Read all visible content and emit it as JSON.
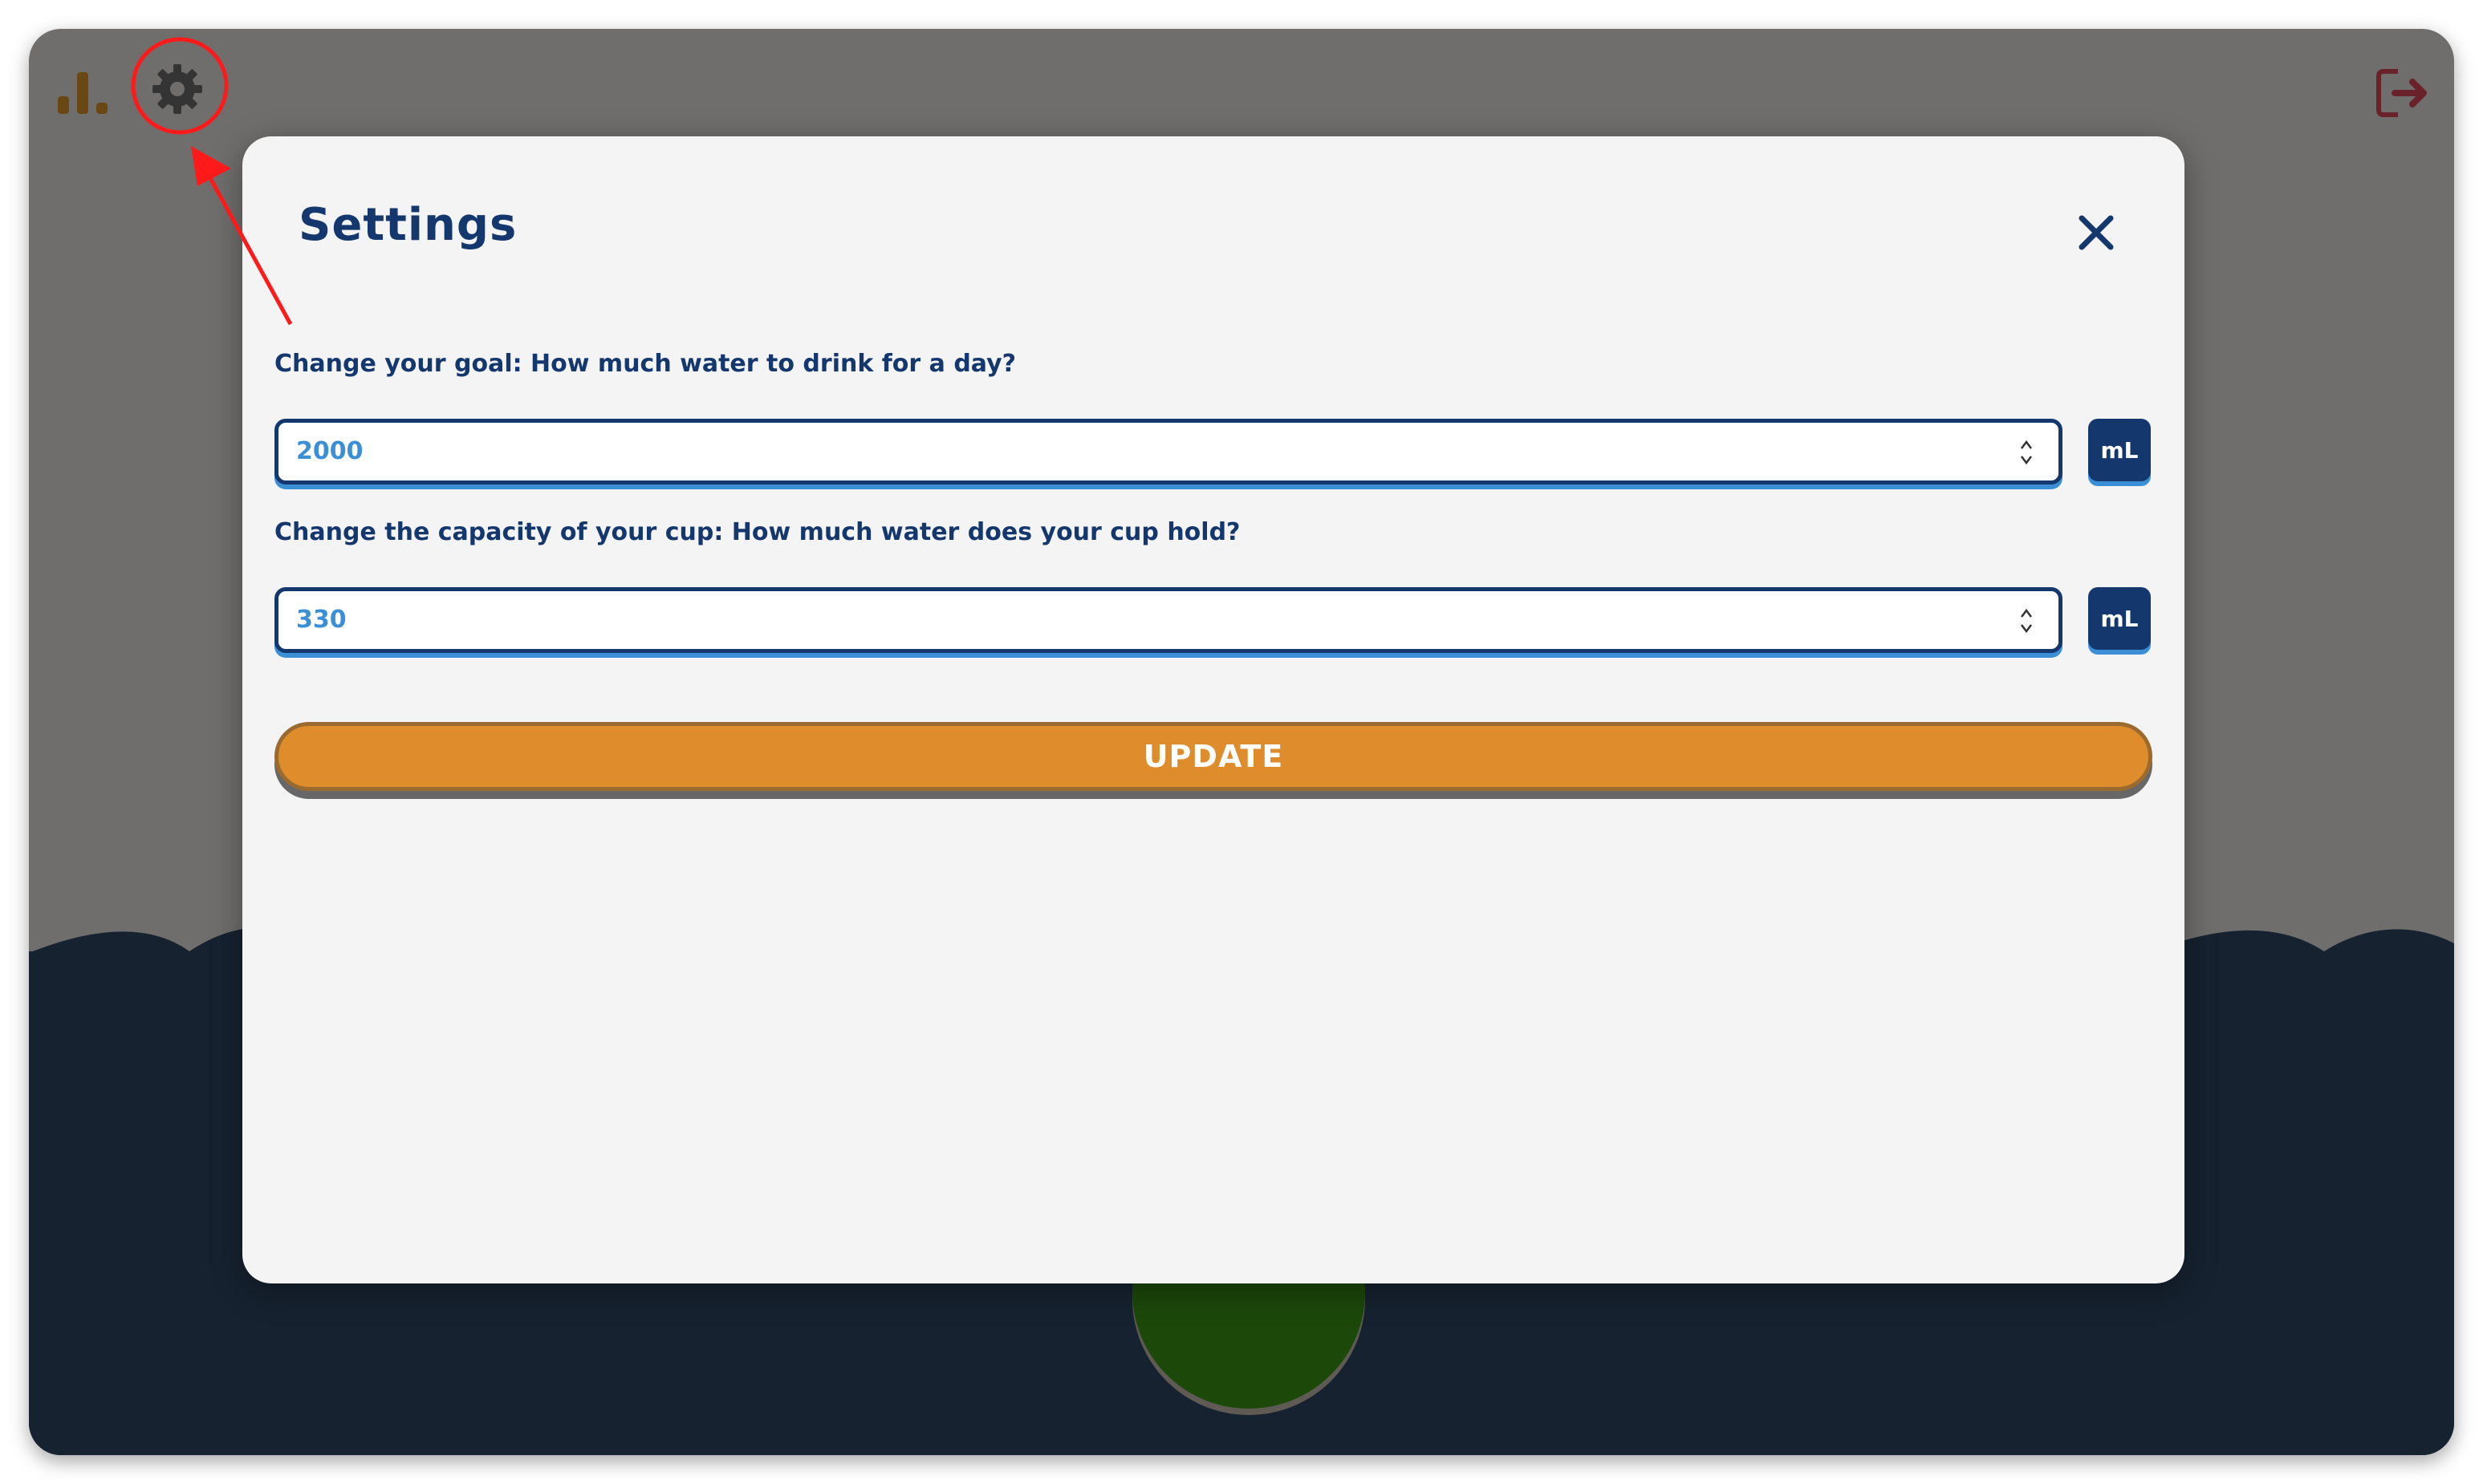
{
  "background": {
    "icons": [
      "stats-icon",
      "gear-icon",
      "logout-icon"
    ]
  },
  "modal": {
    "title": "Settings",
    "close_icon": "close-icon",
    "goal": {
      "label": "Change your goal: How much water to drink for a day?",
      "value": "2000",
      "unit": "mL"
    },
    "cup": {
      "label": "Change the capacity of your cup: How much water does your cup hold?",
      "value": "330",
      "unit": "mL"
    },
    "update_label": "UPDATE"
  },
  "colors": {
    "navy": "#14386e",
    "accent_blue": "#3a8fd6",
    "orange": "#df8c2c",
    "water": "#2f4a66",
    "annotation_red": "#ff1a1a"
  }
}
